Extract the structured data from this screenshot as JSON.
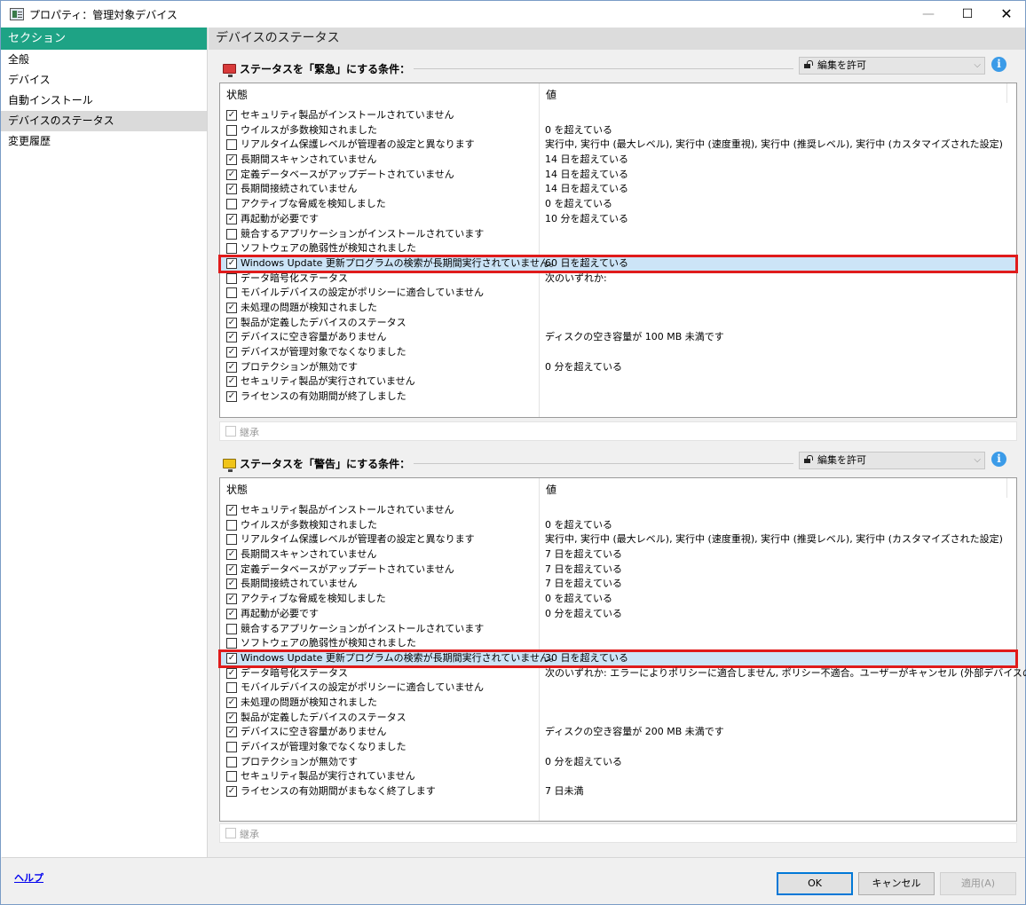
{
  "window": {
    "title": "プロパティ：管理対象デバイス",
    "min": "—",
    "max": "☐",
    "close": "✕"
  },
  "sidebar": {
    "header": "セクション",
    "items": [
      {
        "label": "全般"
      },
      {
        "label": "デバイス"
      },
      {
        "label": "自動インストール"
      },
      {
        "label": "デバイスのステータス"
      },
      {
        "label": "変更履歴"
      }
    ]
  },
  "content": {
    "header": "デバイスのステータス"
  },
  "critical": {
    "title": "ステータスを「緊急」にする条件：",
    "lock_label": "編集を許可",
    "col_state": "状態",
    "col_value": "値",
    "inherit": "継承",
    "rows": [
      {
        "checked": true,
        "label": "セキュリティ製品がインストールされていません",
        "value": ""
      },
      {
        "checked": false,
        "label": "ウイルスが多数検知されました",
        "value": "0 を超えている"
      },
      {
        "checked": false,
        "label": "リアルタイム保護レベルが管理者の設定と異なります",
        "value": "実行中, 実行中 (最大レベル), 実行中 (速度重視), 実行中 (推奨レベル), 実行中 (カスタマイズされた設定)"
      },
      {
        "checked": true,
        "label": "長期間スキャンされていません",
        "value": "14 日を超えている"
      },
      {
        "checked": true,
        "label": "定義データベースがアップデートされていません",
        "value": "14 日を超えている"
      },
      {
        "checked": true,
        "label": "長期間接続されていません",
        "value": "14 日を超えている"
      },
      {
        "checked": false,
        "label": "アクティブな脅威を検知しました",
        "value": "0 を超えている"
      },
      {
        "checked": true,
        "label": "再起動が必要です",
        "value": "10 分を超えている"
      },
      {
        "checked": false,
        "label": "競合するアプリケーションがインストールされています",
        "value": ""
      },
      {
        "checked": false,
        "label": "ソフトウェアの脆弱性が検知されました",
        "value": ""
      },
      {
        "checked": true,
        "label": "Windows Update 更新プログラムの検索が長期間実行されていません。",
        "value": "60 日を超えている"
      },
      {
        "checked": false,
        "label": "データ暗号化ステータス",
        "value": "次のいずれか:"
      },
      {
        "checked": false,
        "label": "モバイルデバイスの設定がポリシーに適合していません",
        "value": ""
      },
      {
        "checked": true,
        "label": "未処理の問題が検知されました",
        "value": ""
      },
      {
        "checked": true,
        "label": "製品が定義したデバイスのステータス",
        "value": ""
      },
      {
        "checked": true,
        "label": "デバイスに空き容量がありません",
        "value": "ディスクの空き容量が 100 MB 未満です"
      },
      {
        "checked": true,
        "label": "デバイスが管理対象でなくなりました",
        "value": ""
      },
      {
        "checked": true,
        "label": "プロテクションが無効です",
        "value": "0 分を超えている"
      },
      {
        "checked": true,
        "label": "セキュリティ製品が実行されていません",
        "value": ""
      },
      {
        "checked": true,
        "label": "ライセンスの有効期間が終了しました",
        "value": ""
      }
    ]
  },
  "warning": {
    "title": "ステータスを「警告」にする条件：",
    "lock_label": "編集を許可",
    "col_state": "状態",
    "col_value": "値",
    "inherit": "継承",
    "rows": [
      {
        "checked": true,
        "label": "セキュリティ製品がインストールされていません",
        "value": ""
      },
      {
        "checked": false,
        "label": "ウイルスが多数検知されました",
        "value": "0 を超えている"
      },
      {
        "checked": false,
        "label": "リアルタイム保護レベルが管理者の設定と異なります",
        "value": "実行中, 実行中 (最大レベル), 実行中 (速度重視), 実行中 (推奨レベル), 実行中 (カスタマイズされた設定)"
      },
      {
        "checked": true,
        "label": "長期間スキャンされていません",
        "value": "7 日を超えている"
      },
      {
        "checked": true,
        "label": "定義データベースがアップデートされていません",
        "value": "7 日を超えている"
      },
      {
        "checked": true,
        "label": "長期間接続されていません",
        "value": "7 日を超えている"
      },
      {
        "checked": true,
        "label": "アクティブな脅威を検知しました",
        "value": "0 を超えている"
      },
      {
        "checked": true,
        "label": "再起動が必要です",
        "value": "0 分を超えている"
      },
      {
        "checked": false,
        "label": "競合するアプリケーションがインストールされています",
        "value": ""
      },
      {
        "checked": false,
        "label": "ソフトウェアの脆弱性が検知されました",
        "value": ""
      },
      {
        "checked": true,
        "label": "Windows Update 更新プログラムの検索が長期間実行されていません。",
        "value": "30 日を超えている"
      },
      {
        "checked": true,
        "label": "データ暗号化ステータス",
        "value": "次のいずれか: エラーによりポリシーに適合しません, ポリシー不適合。ユーザーがキャンセル (外部デバイスのみ)"
      },
      {
        "checked": false,
        "label": "モバイルデバイスの設定がポリシーに適合していません",
        "value": ""
      },
      {
        "checked": true,
        "label": "未処理の問題が検知されました",
        "value": ""
      },
      {
        "checked": true,
        "label": "製品が定義したデバイスのステータス",
        "value": ""
      },
      {
        "checked": true,
        "label": "デバイスに空き容量がありません",
        "value": "ディスクの空き容量が 200 MB 未満です"
      },
      {
        "checked": false,
        "label": "デバイスが管理対象でなくなりました",
        "value": ""
      },
      {
        "checked": false,
        "label": "プロテクションが無効です",
        "value": "0 分を超えている"
      },
      {
        "checked": false,
        "label": "セキュリティ製品が実行されていません",
        "value": ""
      },
      {
        "checked": true,
        "label": "ライセンスの有効期間がまもなく終了します",
        "value": "7 日未満"
      }
    ]
  },
  "footer": {
    "help": "ヘルプ",
    "ok": "OK",
    "cancel": "キャンセル",
    "apply": "適用(A)"
  }
}
